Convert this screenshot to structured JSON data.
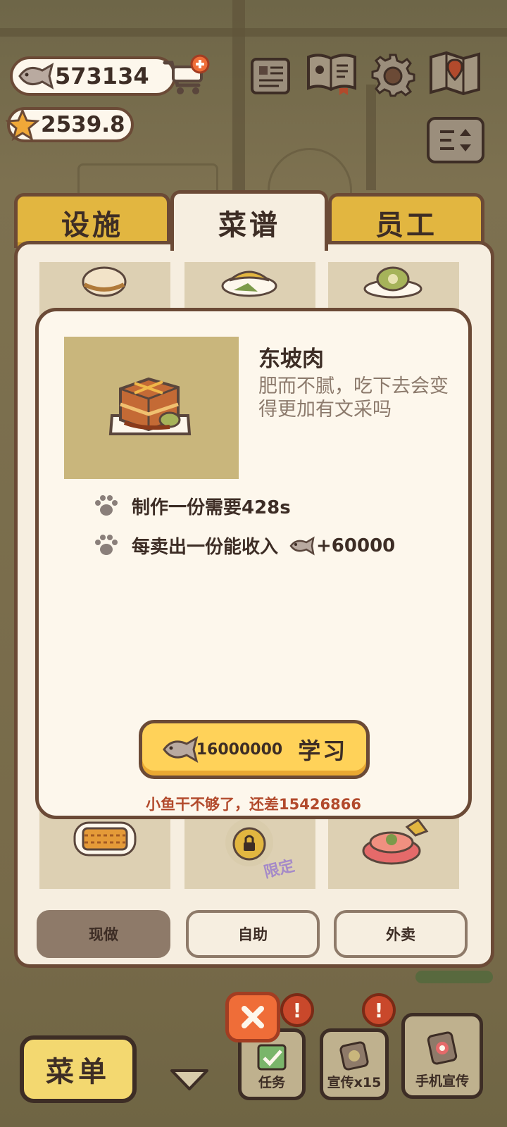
{
  "hud": {
    "fish_count": "573134",
    "star_count": "2539.8"
  },
  "tabs": [
    {
      "label": "设施",
      "active": false
    },
    {
      "label": "菜谱",
      "active": true
    },
    {
      "label": "员工",
      "active": false
    }
  ],
  "recipe": {
    "name": "东坡肉",
    "description": "肥而不腻，吃下去会变得更加有文采吗",
    "stat_time": "制作一份需要428s",
    "stat_income_label": "每卖出一份能收入",
    "stat_income_value": "+60000",
    "learn_cost": "16000000",
    "learn_label": "学习",
    "warning": "小鱼干不够了，还差15426866"
  },
  "locked_badge": "限定",
  "sub_tabs": [
    {
      "label": "现做",
      "active": true
    },
    {
      "label": "自助",
      "active": false
    },
    {
      "label": "外卖",
      "active": false
    }
  ],
  "bottom": {
    "menu_label": "菜单",
    "task_label": "任务",
    "promo_label": "宣传x15",
    "phone_promo_label": "手机宣传",
    "alert_glyph": "!"
  },
  "colors": {
    "panel_bg": "#f6eee0",
    "border": "#6b4a36",
    "tab_gold": "#e2b640",
    "learn_yellow": "#ffd259",
    "warning_red": "#b24a2c"
  }
}
